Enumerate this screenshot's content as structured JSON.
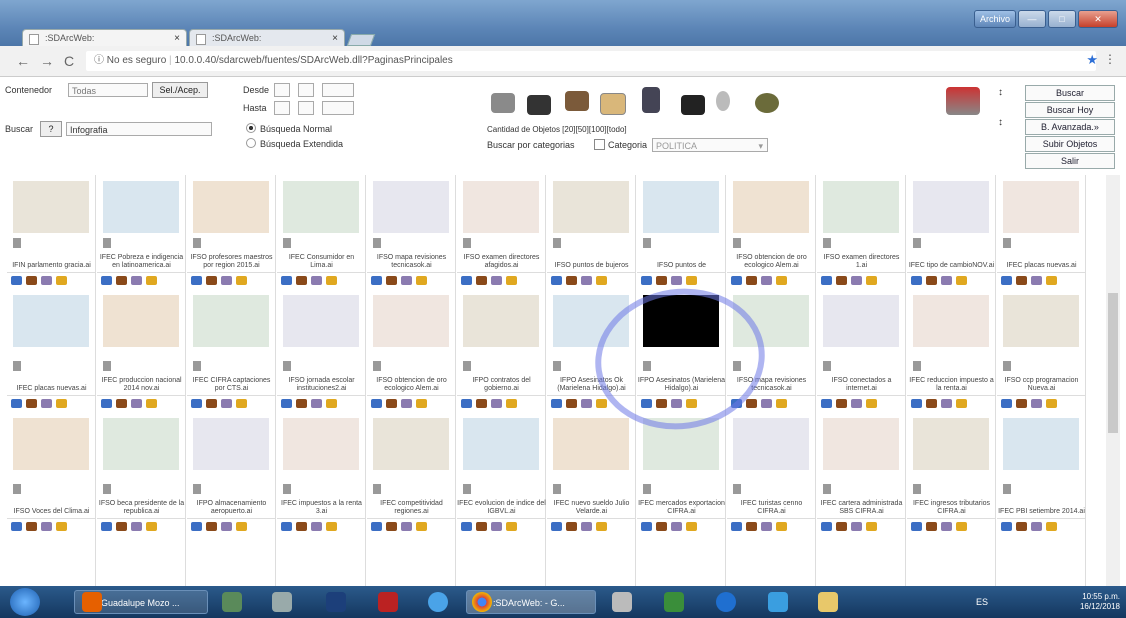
{
  "browser": {
    "tabs": [
      {
        "title": ":SDArcWeb:"
      },
      {
        "title": ":SDArcWeb:"
      }
    ],
    "window_button": "Archivo",
    "address": {
      "security": "No es seguro",
      "url": "10.0.0.40/sdarcweb/fuentes/SDArcWeb.dll?PaginasPrincipales"
    }
  },
  "form": {
    "contenedor_label": "Contenedor",
    "contenedor_value": "Todas",
    "sel_button": "Sel./Acep.",
    "desde_label": "Desde",
    "hasta_label": "Hasta",
    "buscar_label": "Buscar",
    "help_button": "?",
    "search_value": "Infografia",
    "radio_normal": "Búsqueda Normal",
    "radio_extendida": "Búsqueda Extendida",
    "cantidad_label": "Cantidad de Objetos [20][50][100][todo]",
    "categorias_label": "Buscar por categorias",
    "categoria_label": "Categoria",
    "categoria_value": "POLITICA"
  },
  "right_buttons": [
    "Buscar",
    "Buscar Hoy",
    "B. Avanzada.»",
    "Subir Objetos",
    "Salir"
  ],
  "grid": {
    "row1": [
      "IFIN parlamento gracia.ai",
      "IFEC Pobreza e indigencia en latinoamerica.ai",
      "IFSO profesores maestros por region 2015.ai",
      "IFEC Consumidor en Lima.ai",
      "IFSO mapa revisiones tecnicasok.ai",
      "IFSO examen directores afagidos.ai",
      "IFSO puntos de bujeros",
      "IFSO puntos de",
      "IFSO obtencion de oro ecologico Alem.ai",
      "IFSO examen directores 1.ai",
      "IFEC tipo de cambioNOV.ai",
      "IFEC placas nuevas.ai"
    ],
    "row2": [
      "IFEC placas nuevas.ai",
      "IFEC produccion nacional 2014 nov.ai",
      "IFEC CIFRA captaciones por CTS.ai",
      "IFSO jornada escolar instituciones2.ai",
      "IFSO obtencion de oro ecologico Alem.ai",
      "IFPO contratos del gobierno.ai",
      "IFPO Asesinatos Ok (Marielena Hidalgo).ai",
      "IFPO Asesinatos (Marielena Hidalgo).ai",
      "IFSO mapa revisiones tecnicasok.ai",
      "IFSO conectados a internet.ai",
      "IFEC reduccion impuesto a la renta.ai",
      "IFSO ccp programacion Nueva.ai"
    ],
    "row3": [
      "IFSO Voces del Clima.ai",
      "IFSO beca presidente de la republica.ai",
      "IFPO almacenamiento aeropuerto.ai",
      "IFEC impuestos a la renta 3.ai",
      "IFEC competitividad regiones.ai",
      "IFEC evolucion de indice del IGBVL.ai",
      "IFEC nuevo sueldo Julio Velarde.ai",
      "IFEC mercados exportacion CIFRA.ai",
      "IFEC turistas cenno CIFRA.ai",
      "IFEC cartera administrada SBS CIFRA.ai",
      "IFEC ingresos tributarios CIFRA.ai",
      "IFEC PBI setiembre 2014.ai"
    ]
  },
  "taskbar": {
    "items": [
      {
        "label": "Guadalupe Mozo ..."
      },
      {
        "label": ":SDArcWeb: - G..."
      }
    ],
    "lang": "ES",
    "time": "10:55 p.m.",
    "date": "16/12/2018"
  }
}
